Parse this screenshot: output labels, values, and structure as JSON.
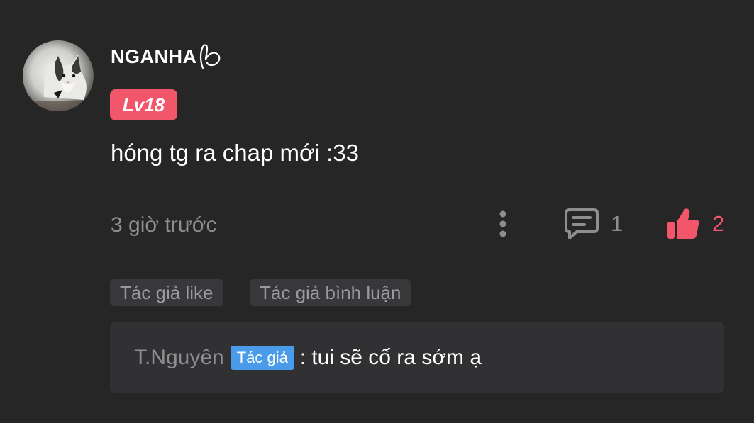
{
  "comment": {
    "username": "NGANHA",
    "username_icon": "hand-heart-doodle-icon",
    "avatar_icon": "cat-avatar-icon",
    "level_badge": "Lv18",
    "text": "hóng tg ra chap mới :33",
    "timestamp": "3 giờ trước",
    "reply_count": "1",
    "like_count": "2",
    "icons": {
      "more": "more-vertical-icon",
      "reply": "comment-bubble-icon",
      "like": "thumbs-up-icon"
    }
  },
  "tags": {
    "author_like": "Tác giả like",
    "author_comment": "Tác giả bình luận"
  },
  "reply": {
    "author": "T.Nguyên",
    "author_badge": "Tác giả",
    "separator": ":",
    "text": "tui sẽ cố ra sớm ạ"
  },
  "colors": {
    "background": "#262627",
    "accent_red": "#f2566a",
    "author_blue": "#4a9bea",
    "muted_text": "#8e8e90",
    "tag_background": "#38383a",
    "reply_background": "#313133"
  }
}
